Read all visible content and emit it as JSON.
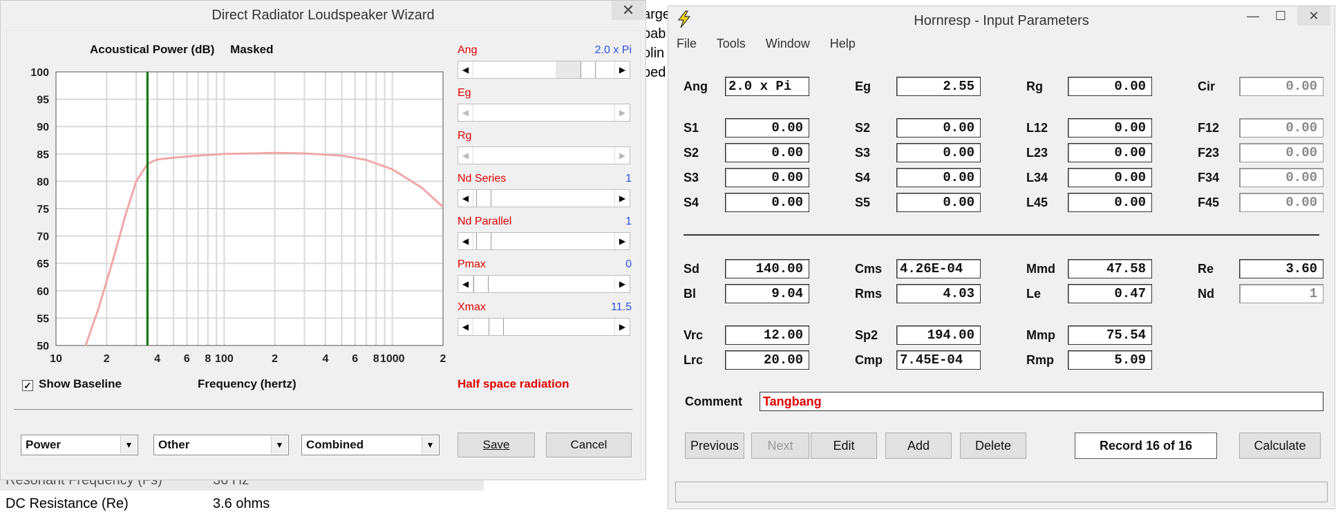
{
  "background": {
    "fragments": [
      "arge",
      "pab",
      "olin",
      "bed"
    ],
    "label_partial": "Resonant Frequency (Fs)",
    "value_partial": "36 Hz",
    "dc_label": "DC Resistance (Re)",
    "dc_value": "3.6 ohms"
  },
  "wizard": {
    "title": "Direct Radiator Loudspeaker Wizard",
    "close": "✕",
    "chart_title": "Acoustical Power (dB)",
    "chart_mode": "Masked",
    "show_baseline": "Show Baseline",
    "sliders": [
      {
        "label": "Ang",
        "value": "2.0 x Pi",
        "level": 0.85,
        "enabled": true
      },
      {
        "label": "Eg",
        "value": "",
        "level": 0,
        "enabled": false
      },
      {
        "label": "Rg",
        "value": "",
        "level": 0,
        "enabled": false
      },
      {
        "label": "Nd  Series",
        "value": "1",
        "level": 0.02,
        "enabled": true
      },
      {
        "label": "Nd  Parallel",
        "value": "1",
        "level": 0.02,
        "enabled": true
      },
      {
        "label": "Pmax",
        "value": "0",
        "level": 0.0,
        "enabled": true
      },
      {
        "label": "Xmax",
        "value": "11.5",
        "level": 0.12,
        "enabled": true
      }
    ],
    "half_space": "Half space radiation",
    "combos": [
      "Power",
      "Other",
      "Combined"
    ],
    "save": "Save",
    "cancel": "Cancel"
  },
  "chart_data": {
    "type": "line",
    "title": "Acoustical Power (dB)   Masked",
    "xlabel": "Frequency (hertz)",
    "ylabel": "",
    "x_scale": "log",
    "xlim": [
      10,
      2000
    ],
    "ylim": [
      50,
      100
    ],
    "y_ticks": [
      "100",
      "95",
      "90",
      "85",
      "80",
      "75",
      "70",
      "65",
      "60",
      "55",
      "50"
    ],
    "x_ticks": [
      "10",
      "2",
      "4",
      "6",
      "8",
      "100",
      "2",
      "4",
      "6",
      "8",
      "1000",
      "2"
    ],
    "series": [
      {
        "color": "#f0a8a8",
        "x": [
          15,
          18,
          22,
          26,
          30,
          35,
          40,
          50,
          70,
          100,
          150,
          200,
          300,
          500,
          700,
          1000,
          1500,
          2000
        ],
        "y": [
          50,
          57,
          66,
          74,
          80,
          83.2,
          84.0,
          84.3,
          84.7,
          85.0,
          85.1,
          85.2,
          85.1,
          84.7,
          83.9,
          82.2,
          78.8,
          75.3
        ]
      }
    ],
    "marker": {
      "x": 35,
      "color": "#007000"
    },
    "grid": true
  },
  "hornresp": {
    "title": "Hornresp - Input Parameters",
    "min": "—",
    "max": "☐",
    "close": "✕",
    "menu": [
      "File",
      "Tools",
      "Window",
      "Help"
    ],
    "top_rows": [
      [
        [
          "Ang",
          "2.0 x Pi"
        ],
        [
          "Eg",
          "2.55"
        ],
        [
          "Rg",
          "0.00"
        ],
        [
          "Cir",
          "0.00"
        ]
      ],
      [
        [
          "S1",
          "0.00"
        ],
        [
          "S2",
          "0.00"
        ],
        [
          "L12",
          "0.00"
        ],
        [
          "F12",
          "0.00"
        ]
      ],
      [
        [
          "S2",
          "0.00"
        ],
        [
          "S3",
          "0.00"
        ],
        [
          "L23",
          "0.00"
        ],
        [
          "F23",
          "0.00"
        ]
      ],
      [
        [
          "S3",
          "0.00"
        ],
        [
          "S4",
          "0.00"
        ],
        [
          "L34",
          "0.00"
        ],
        [
          "F34",
          "0.00"
        ]
      ],
      [
        [
          "S4",
          "0.00"
        ],
        [
          "S5",
          "0.00"
        ],
        [
          "L45",
          "0.00"
        ],
        [
          "F45",
          "0.00"
        ]
      ]
    ],
    "driver_rows": [
      [
        [
          "Sd",
          "140.00"
        ],
        [
          "Cms",
          "4.26E-04"
        ],
        [
          "Mmd",
          "47.58"
        ],
        [
          "Re",
          "3.60"
        ]
      ],
      [
        [
          "Bl",
          "9.04"
        ],
        [
          "Rms",
          "4.03"
        ],
        [
          "Le",
          "0.47"
        ],
        [
          "Nd",
          "1"
        ]
      ]
    ],
    "port_rows": [
      [
        [
          "Vrc",
          "12.00"
        ],
        [
          "Sp2",
          "194.00"
        ],
        [
          "Mmp",
          "75.54"
        ]
      ],
      [
        [
          "Lrc",
          "20.00"
        ],
        [
          "Cmp",
          "7.45E-04"
        ],
        [
          "Rmp",
          "5.09"
        ]
      ]
    ],
    "comment_label": "Comment",
    "comment": "Tangbang",
    "buttons": {
      "previous": "Previous",
      "next": "Next",
      "edit": "Edit",
      "add": "Add",
      "delete": "Delete",
      "calculate": "Calculate"
    },
    "record": "Record 16 of 16"
  }
}
